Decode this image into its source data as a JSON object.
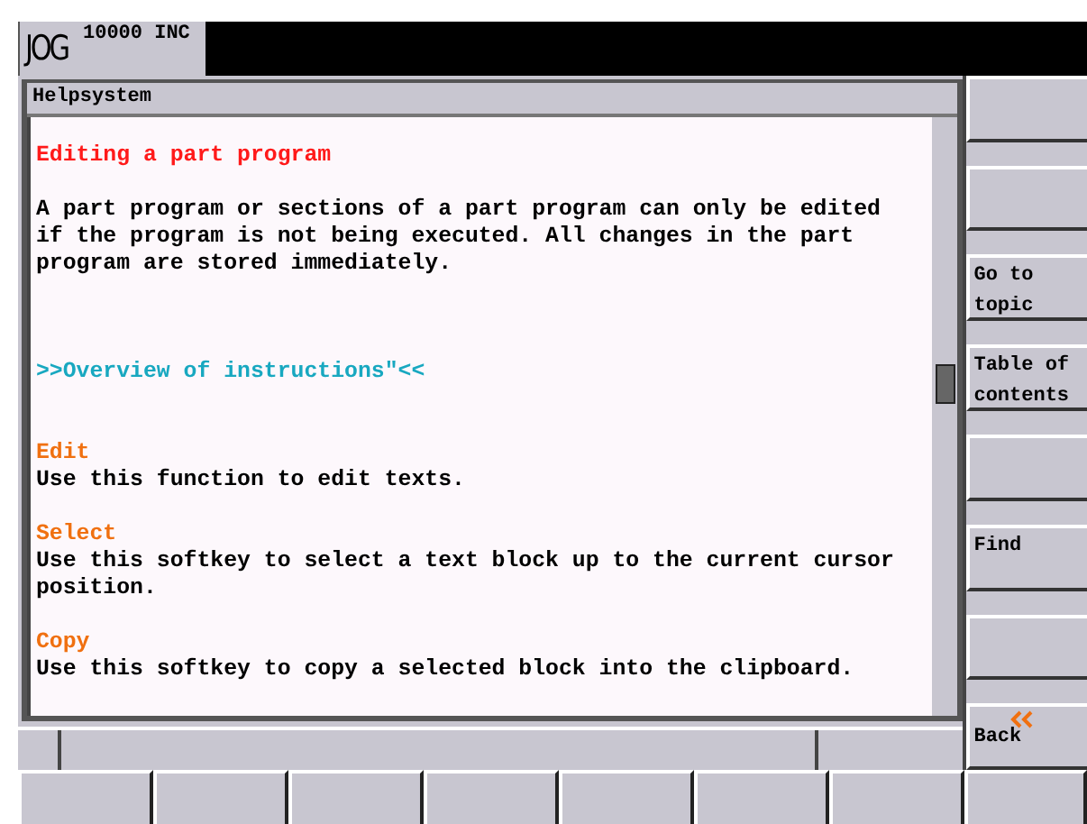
{
  "header": {
    "mode": "JOG",
    "increment": "10000 INC"
  },
  "window": {
    "title": "Helpsystem"
  },
  "content": [
    {
      "kind": "topic",
      "text": "Editing a part program"
    },
    {
      "kind": "paragraph",
      "text": "A part program or sections of a part program can only be edited\nif the program is not being executed. All changes in the part\nprogram are stored immediately."
    },
    {
      "kind": "link",
      "text": ">>Overview of instructions\"<<"
    },
    {
      "kind": "term",
      "text": "Edit"
    },
    {
      "kind": "paragraph",
      "text": "Use this function to edit texts."
    },
    {
      "kind": "term",
      "text": "Select"
    },
    {
      "kind": "paragraph",
      "text": "Use this softkey to select a text block up to the current cursor\nposition."
    },
    {
      "kind": "term",
      "text": "Copy"
    },
    {
      "kind": "paragraph",
      "text": "Use this softkey to copy a selected block into the clipboard."
    }
  ],
  "vertical_softkeys": [
    {
      "kind": "blank"
    },
    {
      "kind": "blank"
    },
    {
      "kind": "text",
      "label": "Go to\ntopic"
    },
    {
      "kind": "text",
      "label": "Table of\ncontents"
    },
    {
      "kind": "blank"
    },
    {
      "kind": "text",
      "label": "Find"
    },
    {
      "kind": "blank"
    },
    {
      "kind": "back",
      "label": "Back"
    }
  ]
}
